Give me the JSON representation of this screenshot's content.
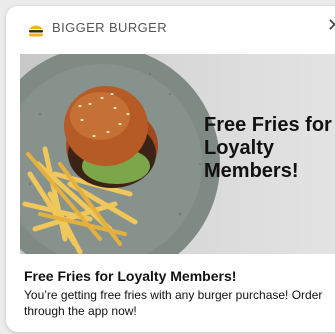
{
  "notification": {
    "app_name": "BIGGER BURGER",
    "app_icon": "burger-icon",
    "close_icon": "close-icon",
    "hero_text": "Free Fries for Loyalty Members!",
    "title": "Free Fries for Loyalty Members!",
    "body": "You’re getting free fries with any burger purchase! Order through the app now!"
  }
}
